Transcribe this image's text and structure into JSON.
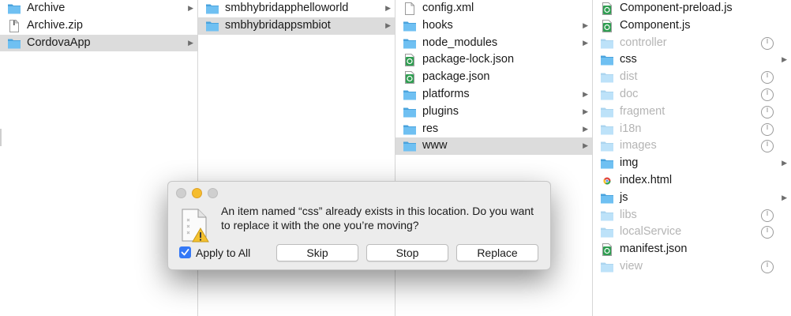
{
  "columns": [
    {
      "id": "col1",
      "items": [
        {
          "name": "Archive",
          "icon": "folder-icon",
          "chevron": true
        },
        {
          "name": "Archive.zip",
          "icon": "zip-file-icon"
        },
        {
          "name": "CordovaApp",
          "icon": "folder-icon",
          "chevron": true,
          "selected": true
        }
      ]
    },
    {
      "id": "col2",
      "items": [
        {
          "name": "smbhybridapphelloworld",
          "icon": "folder-icon",
          "chevron": true
        },
        {
          "name": "smbhybridappsmbiot",
          "icon": "folder-icon",
          "chevron": true,
          "selected": true
        }
      ]
    },
    {
      "id": "col3",
      "items": [
        {
          "name": "config.xml",
          "icon": "xml-file-icon"
        },
        {
          "name": "hooks",
          "icon": "folder-icon",
          "chevron": true
        },
        {
          "name": "node_modules",
          "icon": "folder-icon",
          "chevron": true
        },
        {
          "name": "package-lock.json",
          "icon": "json-file-icon"
        },
        {
          "name": "package.json",
          "icon": "json-file-icon"
        },
        {
          "name": "platforms",
          "icon": "folder-icon",
          "chevron": true
        },
        {
          "name": "plugins",
          "icon": "folder-icon",
          "chevron": true
        },
        {
          "name": "res",
          "icon": "folder-icon",
          "chevron": true
        },
        {
          "name": "www",
          "icon": "folder-icon",
          "chevron": true,
          "selected": true
        }
      ]
    },
    {
      "id": "col4",
      "items": [
        {
          "name": "Component-preload.js",
          "icon": "js-file-icon"
        },
        {
          "name": "Component.js",
          "icon": "js-file-icon"
        },
        {
          "name": "controller",
          "icon": "folder-icon",
          "dim": true,
          "progress": true
        },
        {
          "name": "css",
          "icon": "folder-icon",
          "chevron": true
        },
        {
          "name": "dist",
          "icon": "folder-icon",
          "dim": true,
          "progress": true
        },
        {
          "name": "doc",
          "icon": "folder-icon",
          "dim": true,
          "progress": true
        },
        {
          "name": "fragment",
          "icon": "folder-icon",
          "dim": true,
          "progress": true
        },
        {
          "name": "i18n",
          "icon": "folder-icon",
          "dim": true,
          "progress": true
        },
        {
          "name": "images",
          "icon": "folder-icon",
          "dim": true,
          "progress": true
        },
        {
          "name": "img",
          "icon": "folder-icon",
          "chevron": true
        },
        {
          "name": "index.html",
          "icon": "html-file-icon"
        },
        {
          "name": "js",
          "icon": "folder-icon",
          "chevron": true
        },
        {
          "name": "libs",
          "icon": "folder-icon",
          "dim": true,
          "progress": true
        },
        {
          "name": "localService",
          "icon": "folder-icon",
          "dim": true,
          "progress": true
        },
        {
          "name": "manifest.json",
          "icon": "json-file-icon"
        },
        {
          "name": "view",
          "icon": "folder-icon",
          "dim": true,
          "progress": true
        }
      ]
    }
  ],
  "dialog": {
    "message": "An item named “css” already exists in this location. Do you want to replace it with the one you’re moving?",
    "apply_to_all_label": "Apply to All",
    "apply_to_all_checked": true,
    "skip_label": "Skip",
    "stop_label": "Stop",
    "replace_label": "Replace",
    "icons": [
      "close-icon",
      "minimize-icon",
      "zoom-icon",
      "document-warning-icon",
      "checkmark-icon"
    ]
  },
  "colors": {
    "folder": "#62b8ee",
    "selection": "#dcdcdc",
    "dim_text": "#b4b4b4",
    "checkbox": "#3478f6",
    "minimize_button": "#f5bd2f"
  }
}
